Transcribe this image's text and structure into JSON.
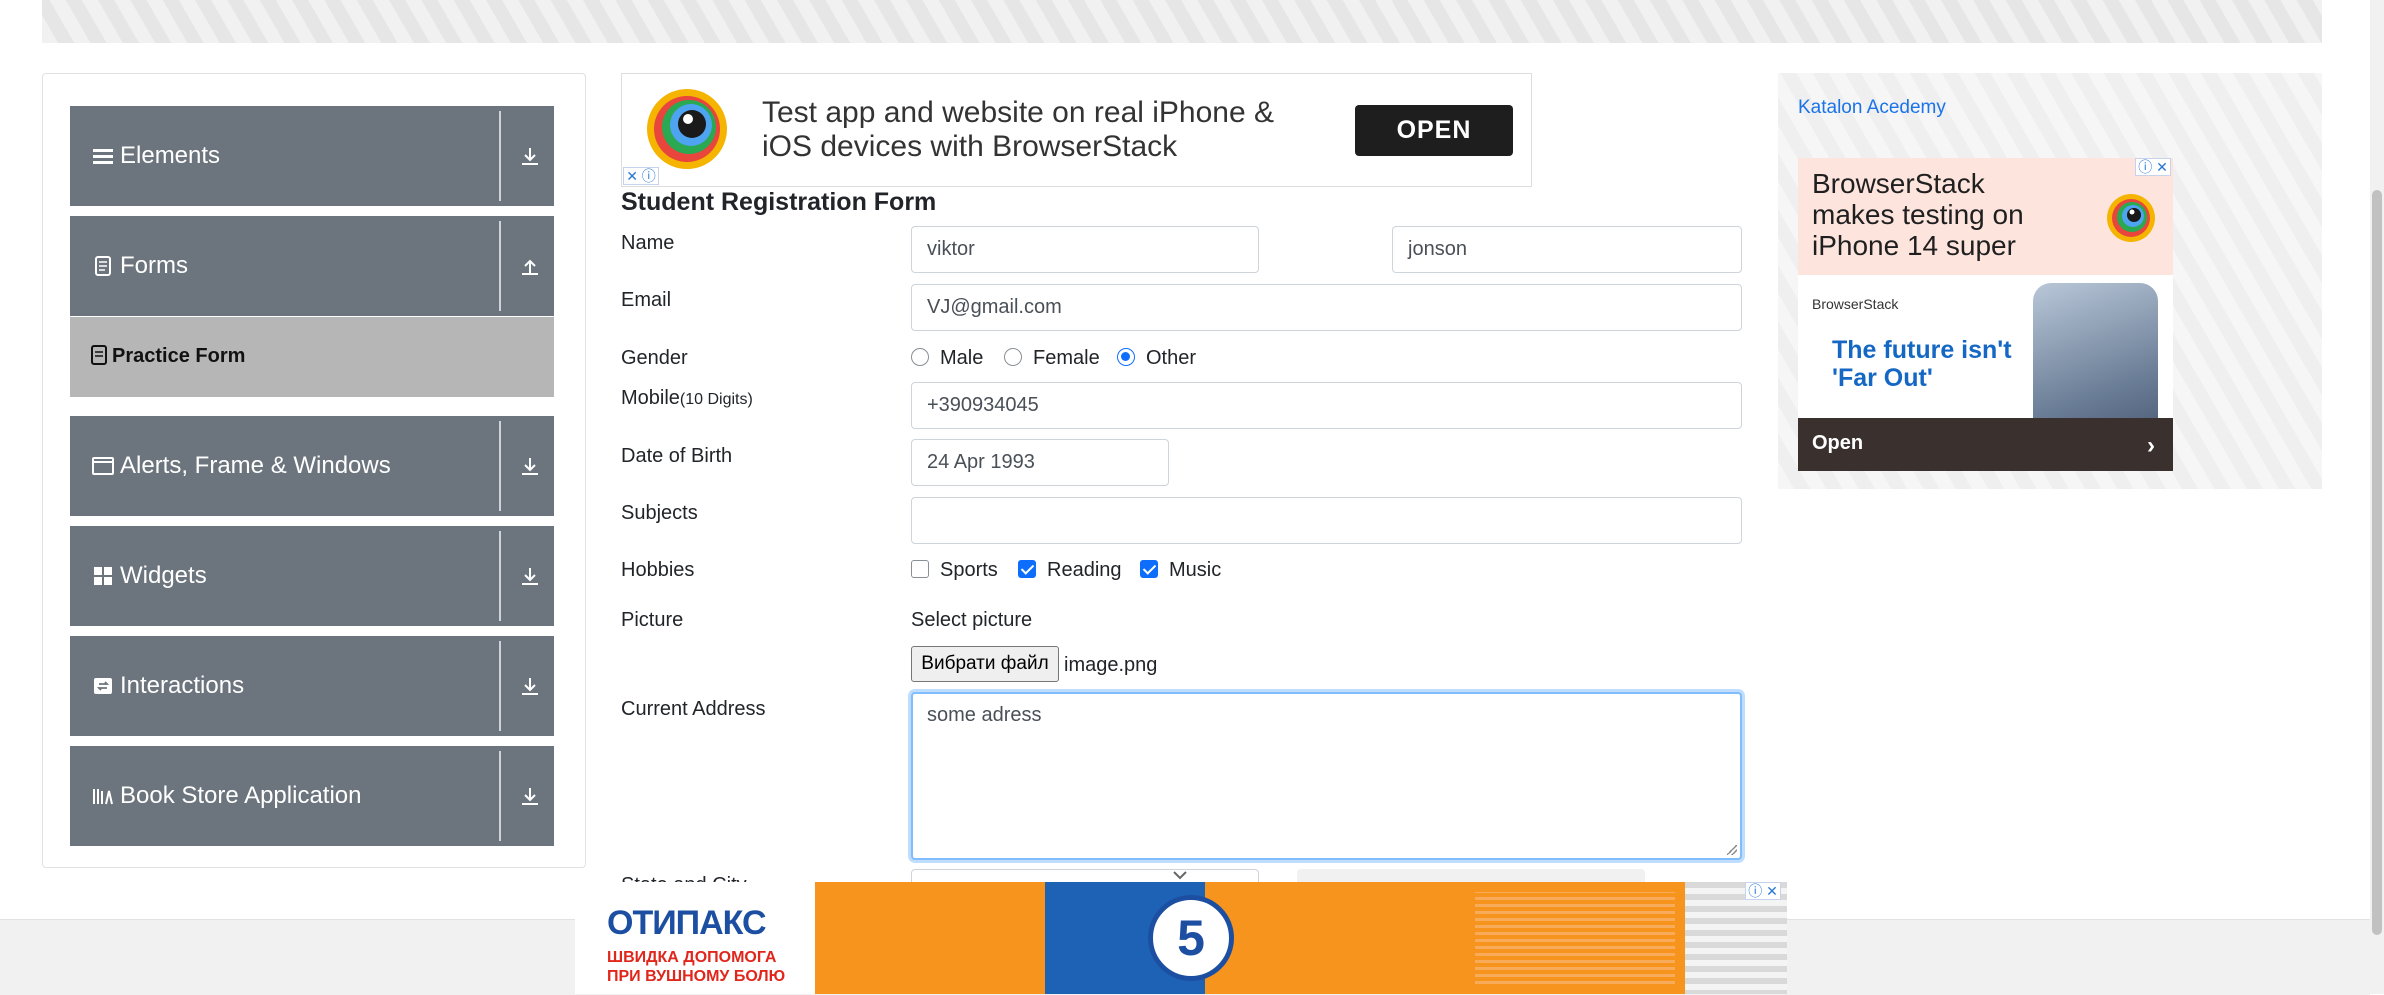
{
  "sidebar": {
    "groups": [
      {
        "label": "Elements",
        "icon": "menu-icon"
      },
      {
        "label": "Forms",
        "icon": "document-icon"
      },
      {
        "label": "Alerts, Frame & Windows",
        "icon": "window-icon"
      },
      {
        "label": "Widgets",
        "icon": "grid-icon"
      },
      {
        "label": "Interactions",
        "icon": "interaction-icon"
      },
      {
        "label": "Book Store Application",
        "icon": "books-icon"
      }
    ],
    "active_item": "Practice Form"
  },
  "top_ad": {
    "text": "Test app and website on real iPhone & iOS devices with BrowserStack",
    "button": "OPEN"
  },
  "form": {
    "title": "Student Registration Form",
    "name_label": "Name",
    "first_name": "viktor",
    "last_name": "jonson",
    "email_label": "Email",
    "email": "VJ@gmail.com",
    "gender_label": "Gender",
    "gender_options": [
      "Male",
      "Female",
      "Other"
    ],
    "gender_selected": "Other",
    "mobile_label": "Mobile",
    "mobile_hint": "(10 Digits)",
    "mobile": "+390934045",
    "dob_label": "Date of Birth",
    "dob": "24 Apr 1993",
    "subjects_label": "Subjects",
    "subjects": "",
    "hobbies_label": "Hobbies",
    "hobbies": [
      {
        "label": "Sports",
        "checked": false
      },
      {
        "label": "Reading",
        "checked": true
      },
      {
        "label": "Music",
        "checked": true
      }
    ],
    "picture_label": "Picture",
    "select_picture": "Select picture",
    "file_button": "Вибрати файл",
    "file_name": "image.png",
    "address_label": "Current Address",
    "address": "some adress",
    "state_city_label": "State and City"
  },
  "right_ad": {
    "broken_image_alt": "Katalon Acedemy",
    "headline": "BrowserStack makes testing on iPhone 14 super",
    "brand": "BrowserStack",
    "tagline": "The future isn't 'Far Out'",
    "open": "Open"
  },
  "bottom_ad": {
    "brand": "ОТИПАКС",
    "subtitle_line1": "ШВИДКА ДОПОМОГА",
    "subtitle_line2": "ПРИ ВУШНОМУ БОЛЮ",
    "badge": "5"
  },
  "colors": {
    "sidebar_group": "#6c757d",
    "sidebar_active": "#b6b6b6",
    "accent": "#0d6efd",
    "ad_orange": "#f7941d"
  }
}
